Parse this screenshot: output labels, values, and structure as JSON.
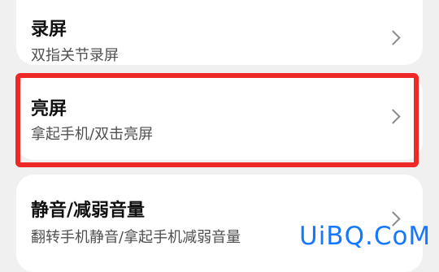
{
  "settings": {
    "items": [
      {
        "title": "录屏",
        "subtitle": "双指关节录屏"
      },
      {
        "title": "亮屏",
        "subtitle": "拿起手机/双击亮屏"
      },
      {
        "title": "静音/减弱音量",
        "subtitle": "翻转手机静音/拿起手机减弱音量"
      }
    ]
  },
  "icons": {
    "chevron": "chevron-right-icon"
  },
  "colors": {
    "highlight": "#ee2727",
    "watermark": "#1677ff",
    "background": "#f0f0f0",
    "card": "#ffffff"
  },
  "watermark": {
    "text": "UiBQ.CoM"
  }
}
